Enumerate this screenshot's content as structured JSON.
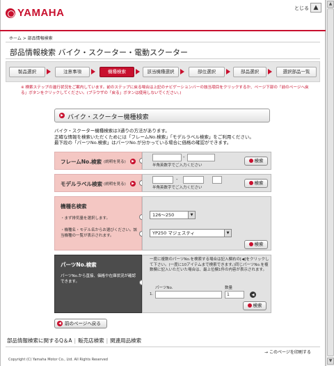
{
  "header": {
    "logo_text": "YAMAHA",
    "close_label": "とじる",
    "close_box": "▲"
  },
  "breadcrumb": "ホーム > 部品情報検索",
  "page_title": "部品情報検索 バイク・スクーター・電動スクーター",
  "steps": [
    {
      "label": "製品選択"
    },
    {
      "label": "注意事項"
    },
    {
      "label": "機種検索"
    },
    {
      "label": "該当機種選択"
    },
    {
      "label": "部位選択"
    },
    {
      "label": "部品選択"
    },
    {
      "label": "選択部品一覧"
    }
  ],
  "note": "※ 検索ステップの進行状況をご案内しています。前のステップに戻る場合は上記のナビゲーションバーの該当項目をクリックするか、ページ下部の「前のページへ戻る」ボタンをクリックしてください。(ブラウザの「戻る」ボタンは使用しないでください。)",
  "section": {
    "title": "バイク・スクーター機種検索"
  },
  "intro": [
    "バイク・スクーター機種検索は3通りの方法があります。",
    "正確な情報を検索いただくためには「フレームNo.検索」「モデルラベル検索」をご利用ください。",
    "最下段の「パーツNo.検索」はパーツNo.が分かっている場合に価格の確認ができます。"
  ],
  "frame_search": {
    "title": "フレームNo.検索",
    "explain": "(説明を見る)",
    "hint": "半角英数字でご入力ください",
    "button": "検索",
    "input1": "",
    "input2": ""
  },
  "model_search": {
    "title": "モデルラベル検索",
    "explain": "(説明を見る)",
    "hint": "半角英数字でご入力ください",
    "button": "検索"
  },
  "model_name_search": {
    "title": "機種名検索",
    "step1": "・まず排気量を選択します。",
    "step2": "・機種名・モデル名からお選びください。該当機種の一覧が表示されます。",
    "displacement_value": "126～250",
    "model_value": "YP250 マジェスティ",
    "button": "検索"
  },
  "parts_search": {
    "title": "パーツNo.検索",
    "desc": "パーツNo.から直接、価格や在庫状況が確認できます。",
    "instructions": "一度に複数のパーツNo.を検索する場合は記入欄右の[◀]をクリックして下さい。(一度に10アイテムまで検索できます。)同じパーツNo.を複数欄に記入いただいた場合は、最上位欄1件の内容が表示されます。",
    "col_partno": "パーツNo.",
    "col_qty": "数量",
    "row_index": "1.",
    "qty_value": "1",
    "button": "検索"
  },
  "back_button": "前のページへ戻る",
  "footer": {
    "link1": "部品情報検索に関するQ＆A",
    "link2": "販売店検索",
    "link3": "関連用品検索",
    "print": "このページを印刷する",
    "copyright": "Copyright (C) Yamaha Motor Co., Ltd. All Rights Reserved"
  },
  "colors": {
    "accent": "#c8102e",
    "pink_panel": "#f4c7c3",
    "dark_panel": "#4c4c4c"
  }
}
